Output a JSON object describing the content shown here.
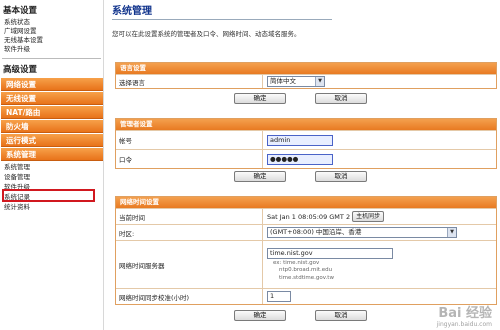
{
  "sidebar": {
    "basic_heading": "基本设置",
    "basic_links": [
      "系统状态",
      "广域网设置",
      "无线基本设置",
      "软件升级"
    ],
    "advanced_heading": "高级设置",
    "nav_buttons": [
      "网络设置",
      "无线设置",
      "NAT/路由",
      "防火墙",
      "运行模式",
      "系统管理"
    ],
    "sub_links": [
      "系统管理",
      "设备管理",
      "软件升级",
      "系统记录",
      "统计资料"
    ]
  },
  "main": {
    "title": "系统管理",
    "description": "您可以在此设置系统的管理者及口令、网络时间、动态域名服务。",
    "language": {
      "heading": "语言设置",
      "label": "选择语言",
      "selected": "简体中文",
      "apply": "确定",
      "cancel": "取消"
    },
    "admin": {
      "heading": "管理者设置",
      "account_label": "帐号",
      "account_value": "admin",
      "password_label": "口令",
      "password_value": "●●●●●",
      "apply": "确定",
      "cancel": "取消"
    },
    "ntp": {
      "heading": "网络时间设置",
      "current_time_label": "当前时间",
      "current_time_value": "Sat Jan  1 08:05:09 GMT 2",
      "sync_button": "主机同步",
      "timezone_label": "时区:",
      "timezone_value": "(GMT+08:00) 中国沿岸、香港",
      "server_label": "网络时间服务器",
      "server_value": "time.nist.gov",
      "server_hints": [
        "ex: time.nist.gov",
        "ntp0.broad.mit.edu",
        "time.stdtime.gov.tw"
      ],
      "sync_interval_label": "网络时间同步校准(小时)",
      "sync_interval_value": "1",
      "apply": "确定",
      "cancel": "取消"
    }
  },
  "watermark": {
    "logo": "Bai 经验",
    "url": "jingyan.baidu.com"
  },
  "colors": {
    "nav_orange": "#e8731a",
    "title_blue": "#10338c",
    "highlight_red": "#d1181f"
  }
}
